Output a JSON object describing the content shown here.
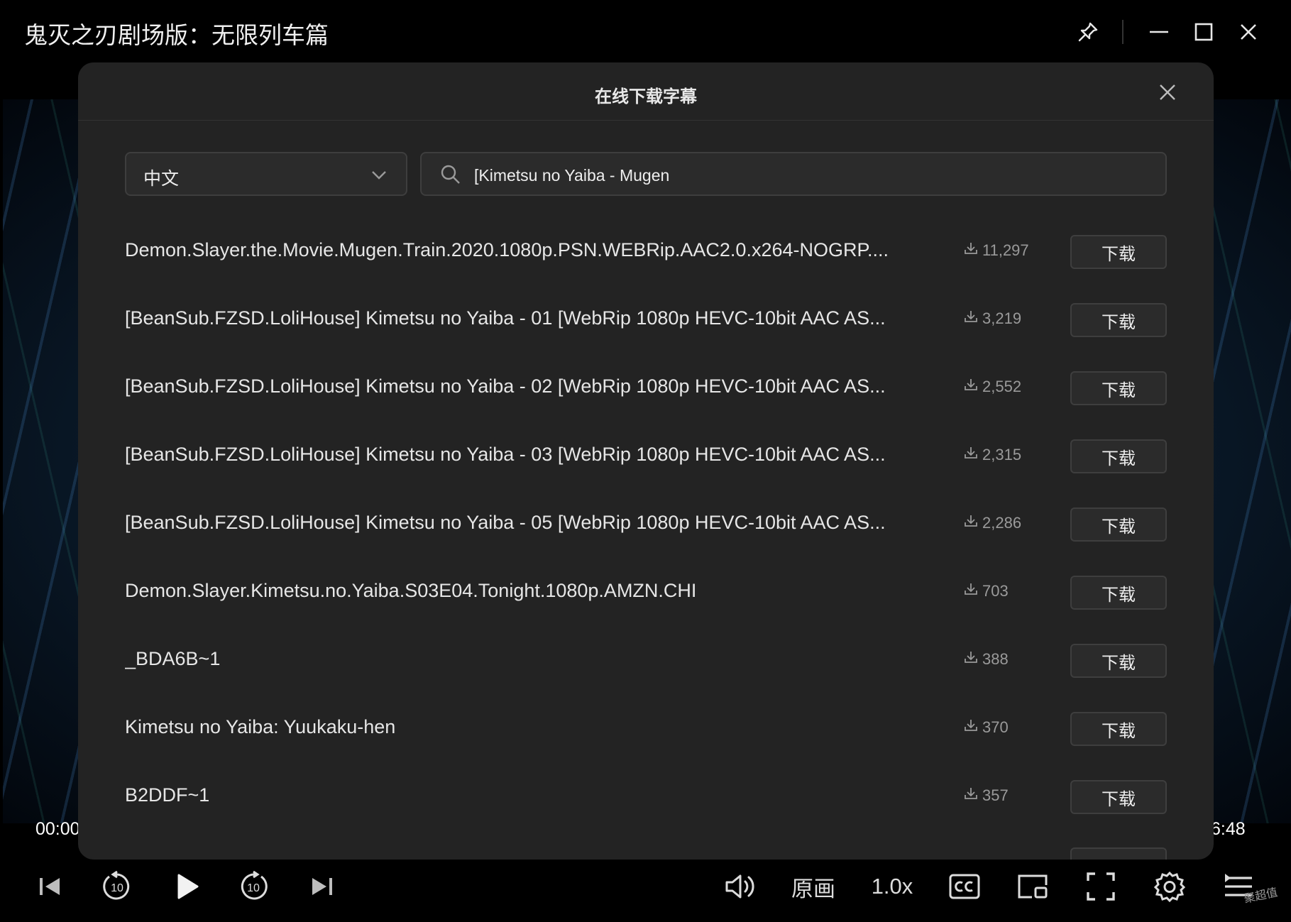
{
  "window": {
    "title": "鬼灭之刃剧场版：无限列车篇"
  },
  "dialog": {
    "title": "在线下载字幕",
    "language_value": "中文",
    "search_value": "[Kimetsu no Yaiba - Mugen"
  },
  "results": [
    {
      "name": "Demon.Slayer.the.Movie.Mugen.Train.2020.1080p.PSN.WEBRip.AAC2.0.x264-NOGRP....",
      "downloads": "11,297",
      "button": "下载"
    },
    {
      "name": "[BeanSub.FZSD.LoliHouse] Kimetsu no Yaiba - 01 [WebRip 1080p HEVC-10bit AAC AS...",
      "downloads": "3,219",
      "button": "下载"
    },
    {
      "name": "[BeanSub.FZSD.LoliHouse] Kimetsu no Yaiba - 02 [WebRip 1080p HEVC-10bit AAC AS...",
      "downloads": "2,552",
      "button": "下载"
    },
    {
      "name": "[BeanSub.FZSD.LoliHouse] Kimetsu no Yaiba - 03 [WebRip 1080p HEVC-10bit AAC AS...",
      "downloads": "2,315",
      "button": "下载"
    },
    {
      "name": "[BeanSub.FZSD.LoliHouse] Kimetsu no Yaiba - 05 [WebRip 1080p HEVC-10bit AAC AS...",
      "downloads": "2,286",
      "button": "下载"
    },
    {
      "name": "Demon.Slayer.Kimetsu.no.Yaiba.S03E04.Tonight.1080p.AMZN.CHI",
      "downloads": "703",
      "button": "下载"
    },
    {
      "name": "_BDA6B~1",
      "downloads": "388",
      "button": "下载"
    },
    {
      "name": "Kimetsu no Yaiba: Yuukaku-hen",
      "downloads": "370",
      "button": "下载"
    },
    {
      "name": "B2DDF~1",
      "downloads": "357",
      "button": "下载"
    }
  ],
  "player": {
    "time_elapsed": "00:00",
    "time_total": "6:48",
    "quality_label": "原画",
    "speed_label": "1.0x",
    "skip_seconds": "10"
  },
  "watermark": "聚超值",
  "icons": [
    "pin-icon",
    "minimize-icon",
    "maximize-icon",
    "close-icon",
    "chevron-down-icon",
    "search-icon",
    "download-count-icon",
    "skip-previous-icon",
    "rewind-10-icon",
    "play-icon",
    "forward-10-icon",
    "skip-next-icon",
    "volume-icon",
    "cc-icon",
    "pip-icon",
    "fullscreen-icon",
    "settings-icon",
    "playlist-icon"
  ]
}
